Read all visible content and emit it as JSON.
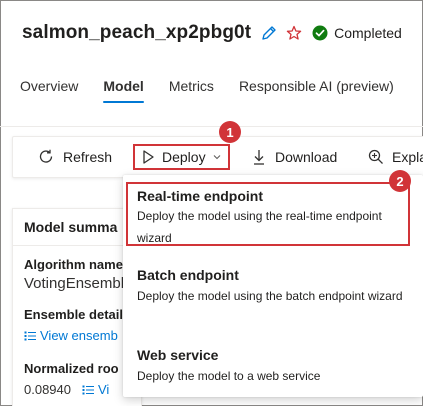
{
  "header": {
    "run_name": "salmon_peach_xp2pbg0t",
    "status": "Completed",
    "icons": {
      "edit": "edit-pencil-icon",
      "favorite": "star-outline-icon",
      "status": "check-circle-icon"
    }
  },
  "tabs": [
    {
      "label": "Overview",
      "active": false
    },
    {
      "label": "Model",
      "active": true
    },
    {
      "label": "Metrics",
      "active": false
    },
    {
      "label": "Responsible AI (preview)",
      "active": false
    }
  ],
  "toolbar": {
    "refresh": "Refresh",
    "deploy": "Deploy",
    "download": "Download",
    "explain": "Expla"
  },
  "callouts": [
    "1",
    "2"
  ],
  "card": {
    "title": "Model summa",
    "algorithm_label": "Algorithm name",
    "algorithm_value": "VotingEnsemble",
    "ensemble_label": "Ensemble detail",
    "ensemble_link": "View ensemb",
    "normalized_label": "Normalized roo",
    "normalized_value": "0.08940",
    "normalized_link": "Vi"
  },
  "deploy_menu": {
    "items": [
      {
        "title": "Real-time endpoint",
        "description": "Deploy the model using the real-time endpoint wizard"
      },
      {
        "title": "Batch endpoint",
        "description": "Deploy the model using the batch endpoint wizard"
      },
      {
        "title": "Web service",
        "description": "Deploy the model to a web service"
      }
    ]
  },
  "colors": {
    "accent": "#0078d4",
    "status_green": "#107c10",
    "callout_red": "#d13438",
    "star": "#d13438"
  }
}
